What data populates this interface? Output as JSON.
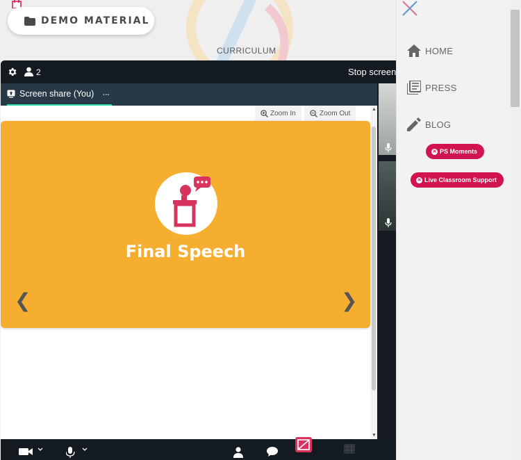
{
  "background": {
    "demo_button_label": "DEMO MATERIAL",
    "curriculum_link": "CURRICULUM"
  },
  "zoom": {
    "participant_count": "2",
    "stop_share_label": "Stop screen",
    "tab_label": "Screen share (You)",
    "tab_more": "···",
    "zoom_in_label": "Zoom In",
    "zoom_out_label": "Zoom Out",
    "slide_title": "Final Speech",
    "prev_arrow": "❮",
    "next_arrow": "❯"
  },
  "menu": {
    "items": [
      {
        "label": "HOME",
        "icon": "home-icon"
      },
      {
        "label": "PRESS",
        "icon": "newspaper-icon"
      },
      {
        "label": "BLOG",
        "icon": "pencil-icon"
      }
    ],
    "pills": [
      {
        "label": "PS Moments"
      },
      {
        "label": "Live Classroom Support"
      }
    ]
  },
  "colors": {
    "slide_bg": "#f5ae2f",
    "accent_pink": "#d11450",
    "tab_underline": "#2fd6a8",
    "zoom_dark": "#131a20"
  }
}
